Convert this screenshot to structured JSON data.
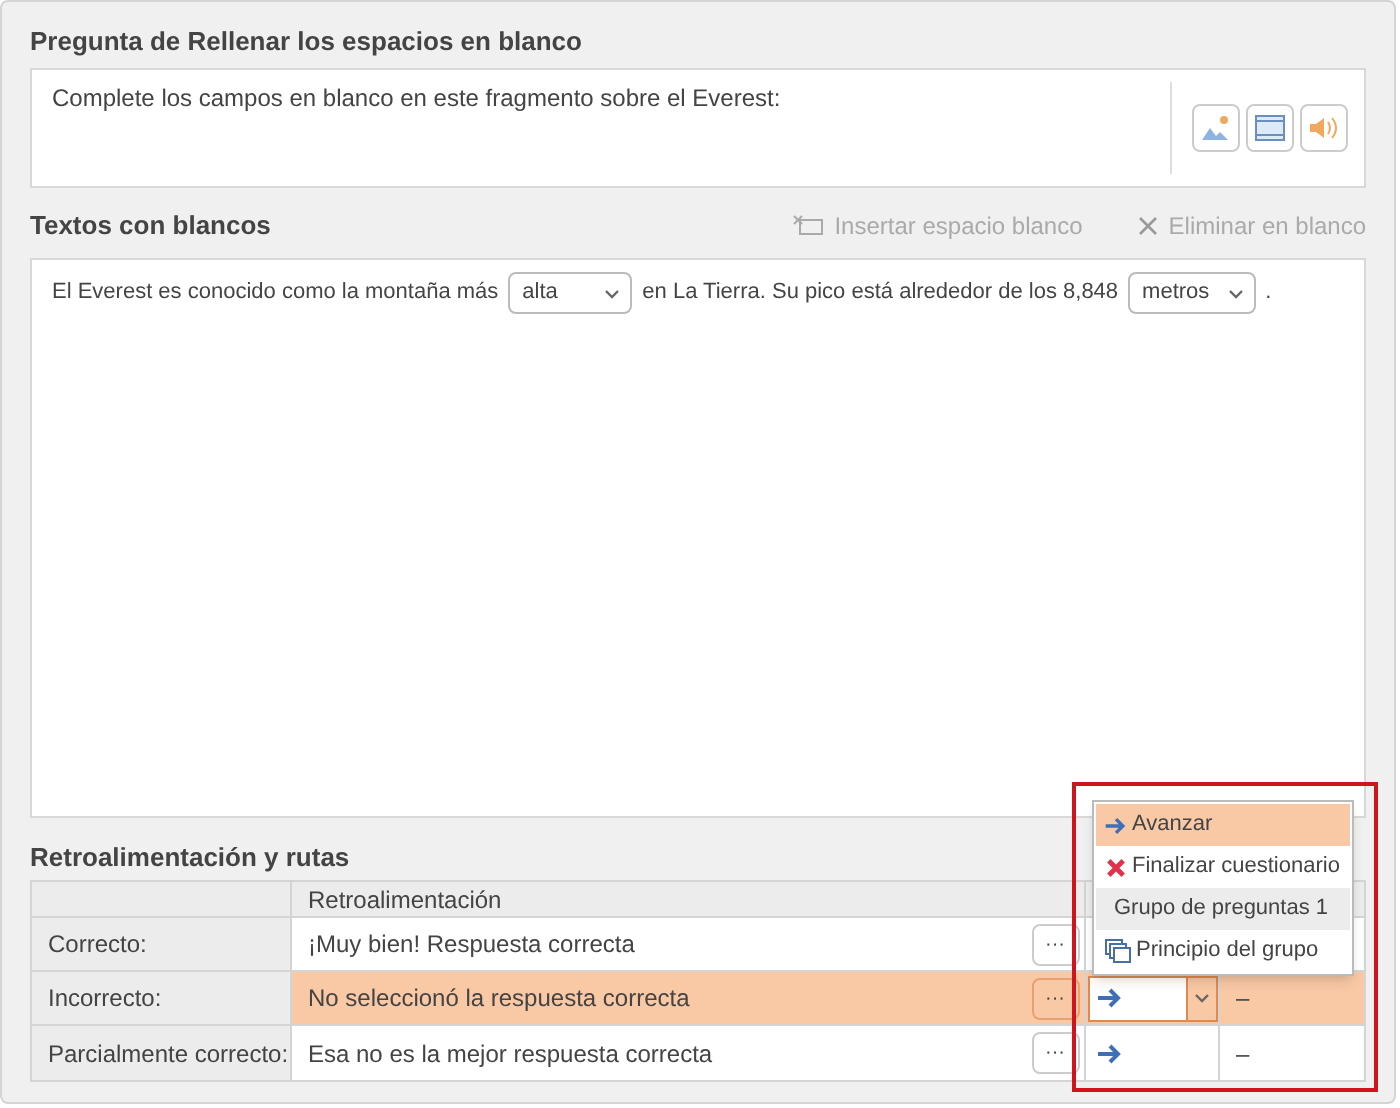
{
  "question": {
    "title": "Pregunta de Rellenar los espacios en blanco",
    "text": "Complete los campos en blanco en este fragmento sobre el Everest:"
  },
  "blanks_section": {
    "title": "Textos con blancos",
    "actions": [
      {
        "kind": "insert",
        "label": "Insertar espacio blanco",
        "disabled": true
      },
      {
        "kind": "delete",
        "label": "Eliminar en blanco",
        "disabled": true
      }
    ],
    "segments": [
      {
        "kind": "text",
        "text": "El Everest es conocido como la montaña más"
      },
      {
        "kind": "blank",
        "value": "alta"
      },
      {
        "kind": "text",
        "text": "en La Tierra. Su pico está alrededor de los 8,848"
      },
      {
        "kind": "blank",
        "value": "metros"
      },
      {
        "kind": "text",
        "text": "."
      }
    ]
  },
  "feedback": {
    "title": "Retroalimentación y rutas",
    "columns": [
      "Retroalimentación"
    ],
    "rows": [
      {
        "label": "Correcto:",
        "feedback": "¡Muy bien! Respuesta correcta",
        "more": "···",
        "selected": false
      },
      {
        "label": "Incorrecto:",
        "feedback": "No seleccionó la respuesta correcta",
        "more": "···",
        "route": "–",
        "selected": true,
        "expanded": true
      },
      {
        "label": "Parcialmente correcto:",
        "feedback": "Esa no es la mejor respuesta correcta",
        "more": "···",
        "route": "–",
        "selected": false,
        "expanded": false
      }
    ],
    "route_menu": [
      {
        "kind": "advance",
        "label": "Avanzar",
        "selected": true
      },
      {
        "kind": "finish",
        "label": "Finalizar cuestionario",
        "selected": false
      },
      {
        "kind": "group",
        "label": "Grupo de preguntas 1",
        "selected": false
      },
      {
        "kind": "group_start",
        "label": "Principio del grupo",
        "selected": false
      }
    ]
  }
}
